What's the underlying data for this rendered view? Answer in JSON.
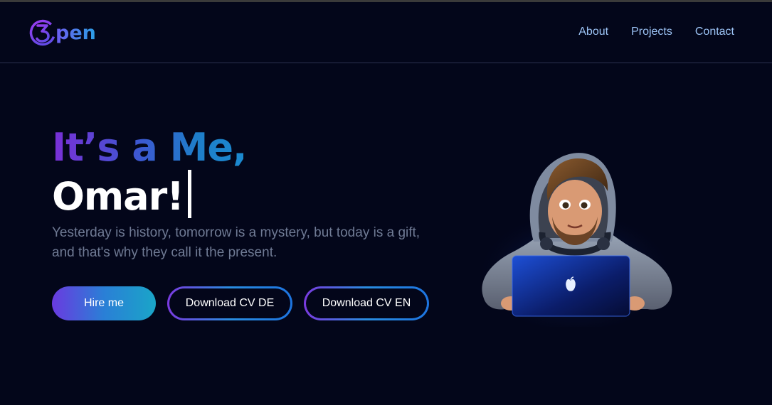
{
  "header": {
    "logo_text": "pen",
    "nav": [
      {
        "label": "About"
      },
      {
        "label": "Projects"
      },
      {
        "label": "Contact"
      }
    ]
  },
  "hero": {
    "greeting": "It’s a Me,",
    "name": "Omar!",
    "tagline": "Yesterday is history, tomorrow is a mystery, but today is a gift, and that's why they call it the present.",
    "buttons": {
      "hire": "Hire me",
      "cv_de": "Download CV DE",
      "cv_en": "Download CV EN"
    }
  },
  "colors": {
    "background": "#03061a",
    "nav_link": "#9cc3f5",
    "gradient_start": "#7a2fd6",
    "gradient_end": "#1b8ad0",
    "tagline": "#6f7a94"
  },
  "icons": {
    "logo": "3-logo-icon",
    "avatar": "developer-avatar-with-laptop",
    "laptop_logo": "apple-icon"
  }
}
